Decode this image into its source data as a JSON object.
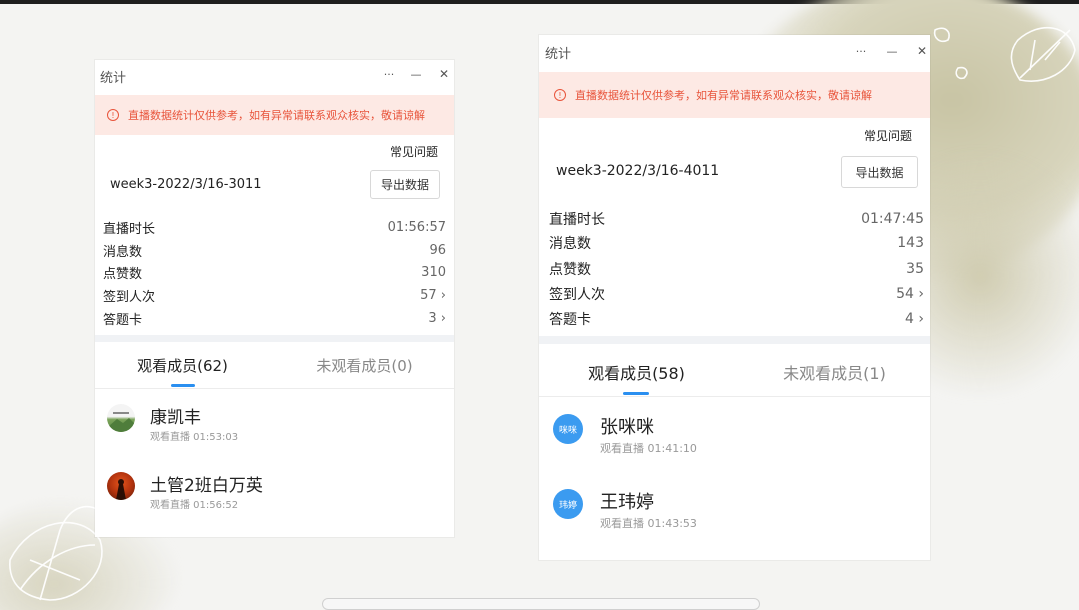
{
  "windows": [
    {
      "title": "统计",
      "controls": {
        "more": "···",
        "minimize": "—",
        "close": "✕"
      },
      "notice": "直播数据统计仅供参考，如有异常请联系观众核实，敬请谅解",
      "faq": "常见问题",
      "session_name": "week3-2022/3/16-3011",
      "export_label": "导出数据",
      "stats": [
        {
          "label": "直播时长",
          "value": "01:56:57",
          "chevron": ""
        },
        {
          "label": "消息数",
          "value": "96",
          "chevron": ""
        },
        {
          "label": "点赞数",
          "value": "310",
          "chevron": ""
        },
        {
          "label": "签到人次",
          "value": "57",
          "chevron": "›"
        },
        {
          "label": "答题卡",
          "value": "3",
          "chevron": "›"
        }
      ],
      "tabs": [
        {
          "label": "观看成员(62)",
          "active": true
        },
        {
          "label": "未观看成员(0)",
          "active": false
        }
      ],
      "members": [
        {
          "name": "康凯丰",
          "time": "观看直播 01:53:03",
          "avatar_text": "",
          "avatar_type": "landscape"
        },
        {
          "name": "土管2班白万英",
          "time": "观看直播 01:56:52",
          "avatar_text": "",
          "avatar_type": "sunset"
        }
      ]
    },
    {
      "title": "统计",
      "controls": {
        "more": "···",
        "minimize": "—",
        "close": "✕"
      },
      "notice": "直播数据统计仅供参考，如有异常请联系观众核实，敬请谅解",
      "faq": "常见问题",
      "session_name": "week3-2022/3/16-4011",
      "export_label": "导出数据",
      "stats": [
        {
          "label": "直播时长",
          "value": "01:47:45",
          "chevron": ""
        },
        {
          "label": "消息数",
          "value": "143",
          "chevron": ""
        },
        {
          "label": "点赞数",
          "value": "35",
          "chevron": ""
        },
        {
          "label": "签到人次",
          "value": "54",
          "chevron": "›"
        },
        {
          "label": "答题卡",
          "value": "4",
          "chevron": "›"
        }
      ],
      "tabs": [
        {
          "label": "观看成员(58)",
          "active": true
        },
        {
          "label": "未观看成员(1)",
          "active": false
        }
      ],
      "members": [
        {
          "name": "张咪咪",
          "time": "观看直播 01:41:10",
          "avatar_text": "咪咪",
          "avatar_type": "text"
        },
        {
          "name": "王玮婷",
          "time": "观看直播 01:43:53",
          "avatar_text": "玮婷",
          "avatar_type": "text"
        }
      ]
    }
  ],
  "colors": {
    "accent": "#2a8ff0",
    "notice_text": "#e8543b",
    "notice_bg": "#fde9e4",
    "avatar_blue": "#3b9bf0"
  }
}
